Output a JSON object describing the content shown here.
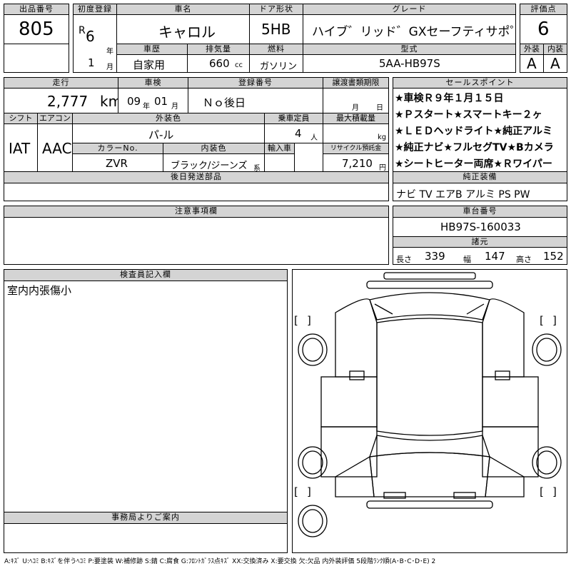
{
  "header": {
    "lot_no": {
      "label": "出品番号",
      "value": "805"
    },
    "first_reg": {
      "label": "初度登録",
      "era": "R",
      "year": "6",
      "year_unit": "年",
      "month": "1",
      "month_unit": "月"
    },
    "car_name": {
      "label": "車名",
      "value": "キャロル"
    },
    "door": {
      "label": "ドア形状",
      "value": "5HB"
    },
    "grade": {
      "label": "グレード",
      "value": "ハイブ゛リッド゛GXセーフティサポ゜ート"
    },
    "score": {
      "label": "評価点",
      "value": "6"
    },
    "history": {
      "label": "車歴",
      "value": "自家用"
    },
    "displacement": {
      "label": "排気量",
      "value": "660",
      "unit": "cc"
    },
    "fuel": {
      "label": "燃料",
      "value": "ガソリン"
    },
    "model": {
      "label": "型式",
      "value": "5AA-HB97S"
    },
    "exterior_grade": {
      "label": "外装",
      "value": "A"
    },
    "interior_grade": {
      "label": "内装",
      "value": "A"
    }
  },
  "info": {
    "mileage": {
      "label": "走行",
      "value": "2,777",
      "unit": "km"
    },
    "inspection": {
      "label": "車検",
      "year": "09",
      "year_unit": "年",
      "month": "01",
      "month_unit": "月"
    },
    "reg_no": {
      "label": "登録番号",
      "value": "Ｎｏ後日"
    },
    "transfer_docs": {
      "label": "譲渡書類期限",
      "month_unit": "月",
      "day_unit": "日"
    },
    "shift": {
      "label": "シフト",
      "value": "IAT"
    },
    "ac": {
      "label": "エアコン",
      "value": "AAC"
    },
    "ext_color": {
      "label": "外装色",
      "value": "パ-ル"
    },
    "capacity": {
      "label": "乗車定員",
      "value": "4",
      "unit": "人"
    },
    "max_load": {
      "label": "最大積載量",
      "unit": "kg"
    },
    "color_no": {
      "label": "カラーNo.",
      "value": "ZVR"
    },
    "int_color": {
      "label": "内装色",
      "value": "ブラック/ジーンズ",
      "unit": "系"
    },
    "import": {
      "label": "輸入車"
    },
    "recycle": {
      "label": "リサイクル預託金",
      "value": "7,210",
      "unit": "円"
    },
    "later_parts": {
      "label": "後日発送部品"
    }
  },
  "sales_points": {
    "label": "セールスポイント",
    "lines": [
      "★車検Ｒ９年１月１５日",
      "★Ｐスタート★スマートキー２ヶ",
      "★ＬＥＤヘッドライト★純正アルミ",
      "★純正ナビ★フルセグTV★Bカメラ",
      "★シートヒーター両席★Ｒワイパー"
    ]
  },
  "equipment": {
    "label": "純正装備",
    "value": "ナビ TV エアB アルミ PS PW"
  },
  "notes": {
    "label": "注意事項欄"
  },
  "chassis": {
    "label": "車台番号",
    "value": "HB97S-160033"
  },
  "dimensions": {
    "label": "諸元",
    "length_label": "長さ",
    "length": "339",
    "width_label": "幅",
    "width": "147",
    "height_label": "高さ",
    "height": "152"
  },
  "inspector": {
    "label": "検査員記入欄",
    "comment": "室内内張傷小"
  },
  "office": {
    "label": "事務局よりご案内"
  },
  "diagram": {
    "bracket_left": "[",
    "bracket_right": "]"
  },
  "legend": "A:ｷｽﾞ U:ﾍｺﾐ B:ｷｽﾞを伴うﾍｺﾐ P:要塗装 W:補修跡 S:錆 C:腐食 G:ﾌﾛﾝﾄｶﾞﾗｽ点ｷｽﾞ XX:交換済み X:要交換 欠:欠品 内外装評価 5段階ﾗﾝｸ順(A･B･C･D･E) 2"
}
